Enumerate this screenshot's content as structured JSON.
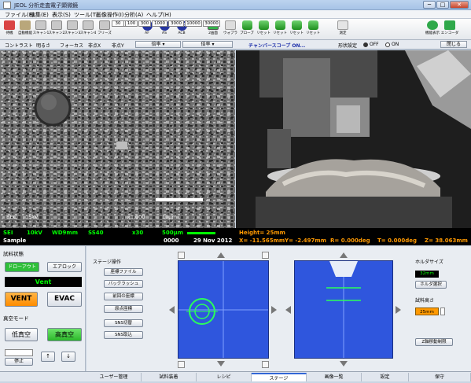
{
  "window": {
    "title": "JEOL 分析走査電子顕微鏡",
    "minimize": "─",
    "maximize": "□",
    "close": "✕"
  },
  "menu": [
    "ファイル(F)",
    "編集(E)",
    "表示(S)",
    "ツール(T)",
    "画像操作(I)",
    "分析(A)",
    "ヘルプ(H)"
  ],
  "toolbar": {
    "left": [
      {
        "label": "待機",
        "icon": "standby-icon",
        "color": "#d94444"
      },
      {
        "label": "自動機能",
        "icon": "auto-function-icon",
        "color": "#b9a77b"
      },
      {
        "label": "スキャン1",
        "icon": "scan1-icon",
        "color": "#c8c8c8"
      },
      {
        "label": "スキャン2",
        "icon": "scan2-icon",
        "color": "#c8c8c8"
      },
      {
        "label": "スキャン3",
        "icon": "scan3-icon",
        "color": "#c8c8c8"
      },
      {
        "label": "スキャン4",
        "icon": "scan4-icon",
        "color": "#c8c8c8"
      },
      {
        "label": "フリーズ",
        "icon": "freeze-icon",
        "color": "#c8c8c8"
      }
    ],
    "round": [
      {
        "text": "AF",
        "label": "AF"
      },
      {
        "text": "AS",
        "label": "AS"
      },
      {
        "text": "ACB",
        "label": "ACB"
      }
    ],
    "magnif_values": [
      "30",
      "100",
      "300",
      "1000",
      "3000",
      "10000",
      "30000"
    ],
    "mid": [
      {
        "label": "2画面",
        "icon": "dual-screen-icon"
      },
      {
        "label": "ウォブラ",
        "icon": "wobbler-icon"
      },
      {
        "label": "プローブ",
        "icon": "probe-icon"
      },
      {
        "label": "リセット",
        "icon": "reset-icon"
      },
      {
        "label": "リセット",
        "icon": "reset2-icon"
      },
      {
        "label": "リセット",
        "icon": "reset3-icon"
      },
      {
        "label": "リセット",
        "icon": "reset4-icon"
      },
      {
        "label": "測定",
        "icon": "measure-icon"
      }
    ],
    "right": [
      {
        "label": "機能表示",
        "icon": "function-display-icon"
      },
      {
        "label": "エンコーダ",
        "icon": "encoder-icon"
      }
    ]
  },
  "controls": {
    "contrast": "コントラスト",
    "brightness": "明るさ",
    "focus": "フォーカス",
    "stigmaX": "非点X",
    "stigmaY": "非点Y",
    "mag_dd": "倍率 ▾",
    "mag_dd2": "倍率 ▾",
    "chamberscope": "チャンバースコープ ON...",
    "shape_setting": "形状設定",
    "off": "OFF",
    "on": "ON",
    "close": "閉じる"
  },
  "sem_overlay": {
    "detector": "BEC",
    "kv": "15kV",
    "mag": "x1,000",
    "scale": "10μm"
  },
  "status": {
    "sig": "SEI",
    "kv": "10kV",
    "wd": "WD9mm",
    "ss": "SS40",
    "mag": "x30",
    "scale": "500μm",
    "height": "Height= 25mm",
    "label": "Sample",
    "code": "0000",
    "date": "29 Nov 2012",
    "x": "X= -11.565mm",
    "y": "Y= -2.497mm",
    "r": "R= 0.000deg",
    "tt": "T= 0.000deg",
    "z": "Z= 38.063mm"
  },
  "left": {
    "exchange_state": "試料状態",
    "intro_btn": "ドローアウト",
    "airlock_btn": "エアロック",
    "state": "Vent",
    "vent": "VENT",
    "evac": "EVAC",
    "vacuum_mode": "真空モード",
    "low_vac": "低真空",
    "high_vac": "高真空",
    "stop": "停止",
    "up": "↑",
    "down": "↓"
  },
  "stage": {
    "title": "ステージ操作",
    "buttons": [
      "座標ファイル",
      "バックラッシュ",
      "前回の座標",
      "原点座標",
      "SNS切替",
      "SNS取込"
    ],
    "holder_size": "ホルダサイズ",
    "holder_value": "32mm",
    "holder_select": "ホルダ選択",
    "sample_height": "試料高さ",
    "sample_height_value": "25mm",
    "z_axis": "Z軸移動制限"
  },
  "tabs": [
    "ユーザー管理",
    "試料装着",
    "レシピ",
    "ステージ",
    "画像一覧",
    "設定",
    "保守"
  ],
  "colors": {
    "accent_orange": "#ff9900",
    "green_on": "#00ff00",
    "view_blue": "#2f56dd"
  }
}
